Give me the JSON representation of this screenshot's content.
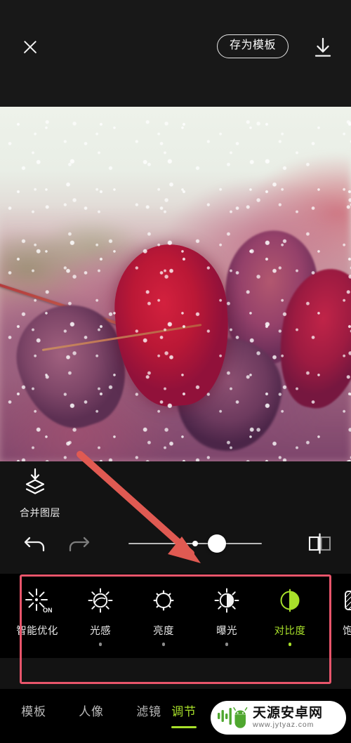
{
  "app": {
    "theme_bg": "#131313",
    "accent_green": "#a8e02a",
    "annotation_red": "#e8556b"
  },
  "topbar": {
    "close_icon": "close-icon",
    "save_template_label": "存为模板",
    "download_icon": "download-icon"
  },
  "photo": {
    "description": "红色与紫色带水珠的树叶特写"
  },
  "panel": {
    "merge_layers": {
      "icon": "merge-layers-icon",
      "label": "合并图层"
    },
    "undo_icon": "undo-icon",
    "redo_icon": "redo-icon",
    "compare_icon": "compare-split-icon",
    "slider": {
      "value": 22,
      "min": -100,
      "max": 100,
      "zero_marker": 0
    }
  },
  "adjust_tools": [
    {
      "label": "智能优化",
      "icon": "auto-enhance-on-icon",
      "active": false,
      "has_dot": false
    },
    {
      "label": "光感",
      "icon": "light-sense-icon",
      "active": false,
      "has_dot": true
    },
    {
      "label": "亮度",
      "icon": "brightness-icon",
      "active": false,
      "has_dot": true
    },
    {
      "label": "曝光",
      "icon": "exposure-icon",
      "active": false,
      "has_dot": true
    },
    {
      "label": "对比度",
      "icon": "contrast-icon",
      "active": true,
      "has_dot": true
    },
    {
      "label": "饱和",
      "icon": "saturation-icon",
      "active": false,
      "has_dot": true
    }
  ],
  "tabs": [
    {
      "label": "模板",
      "active": false
    },
    {
      "label": "人像",
      "active": false
    },
    {
      "label": "滤镜",
      "active": false
    },
    {
      "label": "调节",
      "active": true
    }
  ],
  "annotations": {
    "arrow": "red-arrow-pointing-to-adjust-strip",
    "highlight_box": "red-rectangle-around-adjust-strip"
  },
  "watermark": {
    "title": "天源安卓网",
    "url": "www.jytyaz.com",
    "logo_icon": "android-robot-icon"
  }
}
